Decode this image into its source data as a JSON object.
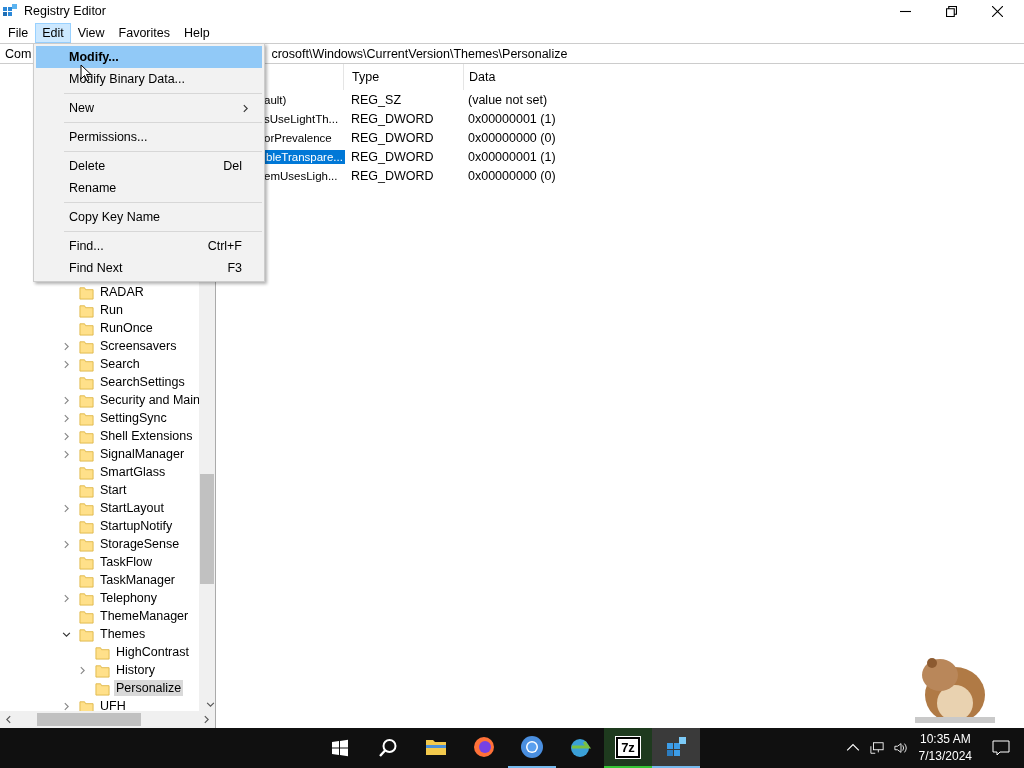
{
  "window": {
    "title": "Registry Editor"
  },
  "menubar": [
    {
      "label": "File",
      "selected": false
    },
    {
      "label": "Edit",
      "selected": true
    },
    {
      "label": "View",
      "selected": false
    },
    {
      "label": "Favorites",
      "selected": false
    },
    {
      "label": "Help",
      "selected": false
    }
  ],
  "address": {
    "start": "Com",
    "end": "crosoft\\Windows\\CurrentVersion\\Themes\\Personalize"
  },
  "tree": [
    {
      "label": "RADAR",
      "selected": false
    },
    {
      "label": "Run",
      "selected": false
    },
    {
      "label": "RunOnce",
      "selected": false
    },
    {
      "label": "Screensavers",
      "expanded": false,
      "selected": false
    },
    {
      "label": "Search",
      "expanded": false,
      "selected": false
    },
    {
      "label": "SearchSettings",
      "selected": false
    },
    {
      "label": "Security and Main",
      "expanded": false,
      "selected": false
    },
    {
      "label": "SettingSync",
      "expanded": false,
      "selected": false
    },
    {
      "label": "Shell Extensions",
      "expanded": false,
      "selected": false
    },
    {
      "label": "SignalManager",
      "expanded": false,
      "selected": false
    },
    {
      "label": "SmartGlass",
      "selected": false
    },
    {
      "label": "Start",
      "selected": false
    },
    {
      "label": "StartLayout",
      "expanded": false,
      "selected": false
    },
    {
      "label": "StartupNotify",
      "selected": false
    },
    {
      "label": "StorageSense",
      "expanded": false,
      "selected": false
    },
    {
      "label": "TaskFlow",
      "selected": false
    },
    {
      "label": "TaskManager",
      "selected": false
    },
    {
      "label": "Telephony",
      "expanded": false,
      "selected": false
    },
    {
      "label": "ThemeManager",
      "selected": false
    },
    {
      "label": "Themes",
      "expanded": true,
      "selected": false,
      "children": [
        {
          "label": "HighContrast",
          "selected": false
        },
        {
          "label": "History",
          "expanded": false,
          "selected": false
        },
        {
          "label": "Personalize",
          "selected": true
        }
      ]
    },
    {
      "label": "UFH",
      "expanded": false,
      "selected": false
    }
  ],
  "values": {
    "columns": [
      "Type",
      "Data"
    ],
    "rows": [
      {
        "name": "ault)",
        "type": "REG_SZ",
        "data": "(value not set)",
        "selected": false
      },
      {
        "name": "sUseLightTh...",
        "type": "REG_DWORD",
        "data": "0x00000001 (1)",
        "selected": false
      },
      {
        "name": "orPrevalence",
        "type": "REG_DWORD",
        "data": "0x00000000 (0)",
        "selected": false
      },
      {
        "name": "bleTranspare...",
        "type": "REG_DWORD",
        "data": "0x00000001 (1)",
        "selected": true
      },
      {
        "name": "emUsesLigh...",
        "type": "REG_DWORD",
        "data": "0x00000000 (0)",
        "selected": false
      }
    ]
  },
  "edit_menu": [
    {
      "kind": "item",
      "label": "Modify...",
      "selected": true
    },
    {
      "kind": "item",
      "label": "Modify Binary Data...",
      "selected": false
    },
    {
      "kind": "separator"
    },
    {
      "kind": "submenu",
      "label": "New",
      "selected": false
    },
    {
      "kind": "separator"
    },
    {
      "kind": "item",
      "label": "Permissions...",
      "selected": false
    },
    {
      "kind": "separator"
    },
    {
      "kind": "item",
      "label": "Delete",
      "shortcut": "Del",
      "selected": false
    },
    {
      "kind": "item",
      "label": "Rename",
      "selected": false
    },
    {
      "kind": "separator"
    },
    {
      "kind": "item",
      "label": "Copy Key Name",
      "selected": false
    },
    {
      "kind": "separator"
    },
    {
      "kind": "item",
      "label": "Find...",
      "shortcut": "Ctrl+F",
      "selected": false
    },
    {
      "kind": "item",
      "label": "Find Next",
      "shortcut": "F3",
      "selected": false
    }
  ],
  "taskbar": {
    "apps": [
      {
        "kind": "folder",
        "running": false,
        "selected": false
      },
      {
        "kind": "firefox",
        "running": false,
        "selected": false
      },
      {
        "kind": "chrome",
        "running": true,
        "selected": false
      },
      {
        "kind": "globe",
        "running": false,
        "selected": false
      },
      {
        "kind": "archiver",
        "text": "7z",
        "running": true,
        "selected": false
      },
      {
        "kind": "registry",
        "running": true,
        "selected": true
      }
    ],
    "time": "10:35 AM",
    "date": "7/13/2024"
  }
}
